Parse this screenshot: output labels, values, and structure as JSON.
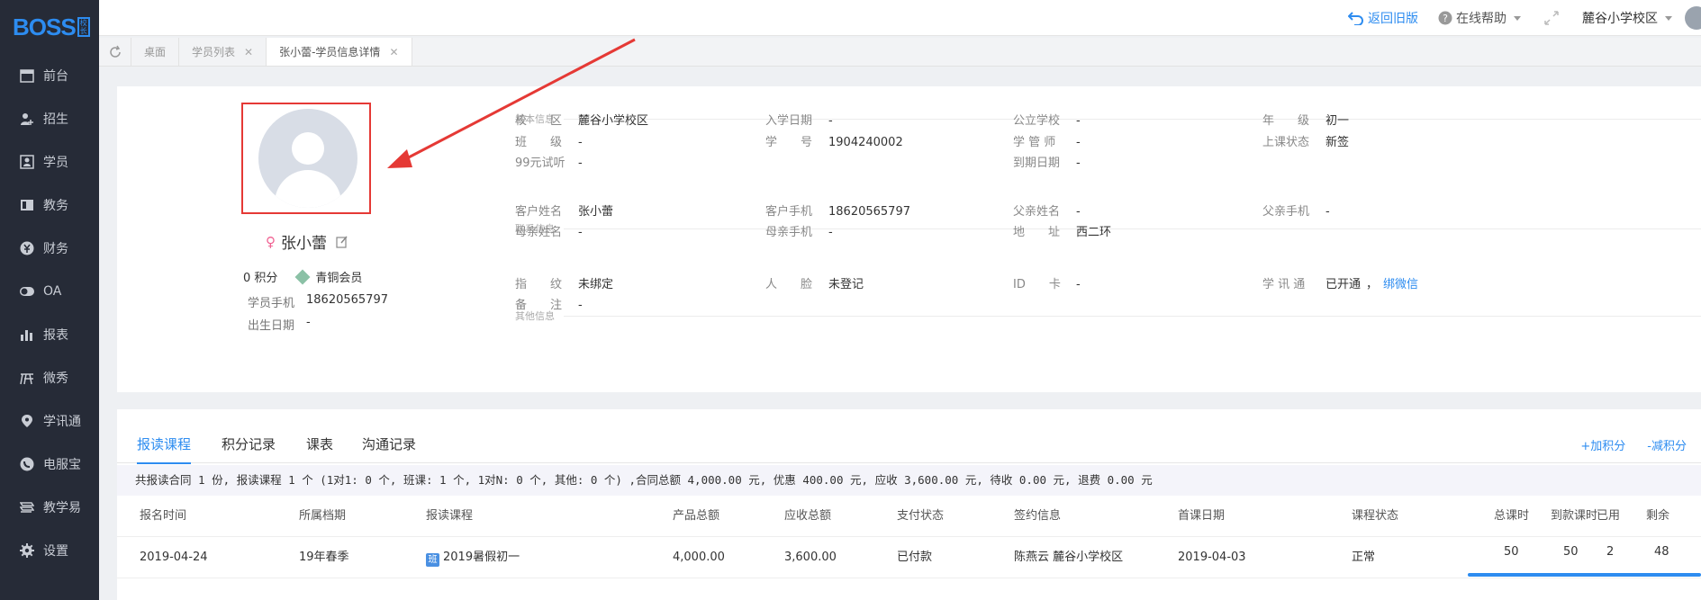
{
  "logo": {
    "text": "BOSS",
    "badge": "校长"
  },
  "sidebar": {
    "items": [
      {
        "label": "前台",
        "icon": "calendar-icon"
      },
      {
        "label": "招生",
        "icon": "user-plus-icon"
      },
      {
        "label": "学员",
        "icon": "student-card-icon"
      },
      {
        "label": "教务",
        "icon": "book-icon"
      },
      {
        "label": "财务",
        "icon": "yen-icon"
      },
      {
        "label": "OA",
        "icon": "toggle-icon"
      },
      {
        "label": "报表",
        "icon": "bar-chart-icon"
      },
      {
        "label": "微秀",
        "icon": "wechat-show-icon"
      },
      {
        "label": "学讯通",
        "icon": "location-pin-icon"
      },
      {
        "label": "电服宝",
        "icon": "phone-service-icon"
      },
      {
        "label": "教学易",
        "icon": "teaching-icon"
      },
      {
        "label": "设置",
        "icon": "gear-icon"
      }
    ]
  },
  "topbar": {
    "back_old": "返回旧版",
    "help": "在线帮助",
    "campus": "麓谷小学校区"
  },
  "tabs": [
    {
      "label": "桌面",
      "closable": false
    },
    {
      "label": "学员列表",
      "closable": true
    },
    {
      "label": "张小蕾-学员信息详情",
      "closable": true,
      "active": true
    }
  ],
  "profile": {
    "name": "张小蕾",
    "points": "0 积分",
    "member_level": "青铜会员",
    "phone_label": "学员手机",
    "phone": "18620565797",
    "birthday_label": "出生日期",
    "birthday": "-"
  },
  "basic": {
    "title": "基本信息",
    "fields": [
      {
        "k": "校　　区",
        "v": "麓谷小学校区"
      },
      {
        "k": "入学日期",
        "v": "-"
      },
      {
        "k": "公立学校",
        "v": "-"
      },
      {
        "k": "年　　级",
        "v": "初一"
      },
      {
        "k": "班　　级",
        "v": "-"
      },
      {
        "k": "学　　号",
        "v": "1904240002"
      },
      {
        "k": "学 管 师",
        "v": "-"
      },
      {
        "k": "上课状态",
        "v": "新签"
      },
      {
        "k": "99元试听",
        "v": "-"
      },
      {
        "k": "到期日期",
        "v": "-"
      }
    ]
  },
  "contact": {
    "title": "联系信息",
    "fields": [
      {
        "k": "客户姓名",
        "v": "张小蕾"
      },
      {
        "k": "客户手机",
        "v": "18620565797"
      },
      {
        "k": "父亲姓名",
        "v": "-"
      },
      {
        "k": "父亲手机",
        "v": "-"
      },
      {
        "k": "母亲姓名",
        "v": "-"
      },
      {
        "k": "母亲手机",
        "v": "-"
      },
      {
        "k": "地　　址",
        "v": "西二环"
      }
    ]
  },
  "other": {
    "title": "其他信息",
    "fields": [
      {
        "k": "指　　纹",
        "v": "未绑定"
      },
      {
        "k": "人　　脸",
        "v": "未登记"
      },
      {
        "k": "ID　　卡",
        "v": "-"
      },
      {
        "k": "学 讯 通",
        "v": "已开通",
        "v2": "绑微信"
      },
      {
        "k": "备　　注",
        "v": "-"
      }
    ]
  },
  "course_tabs": [
    "报读课程",
    "积分记录",
    "课表",
    "沟通记录"
  ],
  "points_actions": {
    "add": "+加积分",
    "sub": "-减积分"
  },
  "summary": "共报读合同 1 份, 报读课程 1 个 (1对1: 0 个, 班课: 1 个, 1对N: 0 个, 其他: 0 个) ,合同总额 4,000.00 元, 优惠 400.00 元, 应收 3,600.00 元, 待收 0.00 元, 退费 0.00 元",
  "table": {
    "headers": [
      "报名时间",
      "所属档期",
      "报读课程",
      "产品总额",
      "应收总额",
      "支付状态",
      "签约信息",
      "首课日期",
      "课程状态",
      "总课时",
      "到款课时",
      "已用",
      "剩余"
    ],
    "rows": [
      [
        "2019-04-24",
        "19年春季",
        "2019暑假初一",
        "4,000.00",
        "3,600.00",
        "已付款",
        "陈燕云 麓谷小学校区",
        "2019-04-03",
        "正常",
        "50",
        "50",
        "2",
        "48"
      ]
    ],
    "class_badge": "班"
  },
  "colors": {
    "accent": "#2d8cf0",
    "sidebar_bg": "#262b37",
    "highlight_red": "#e53935"
  }
}
